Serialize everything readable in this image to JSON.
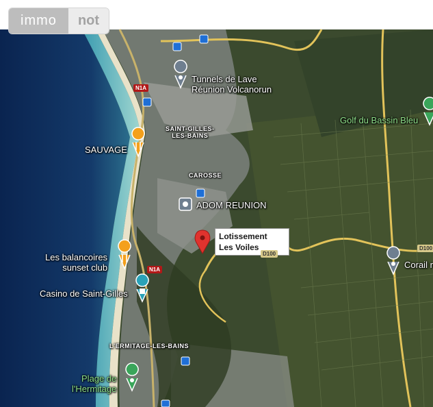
{
  "logo": {
    "part1": "immo",
    "part2": "not"
  },
  "marker": {
    "label_line1": "Lotissement",
    "label_line2": "Les Voiles"
  },
  "places": {
    "tunnels_line1": "Tunnels de Lave",
    "tunnels_line2": "Réunion Volcanorun",
    "golf": "Golf du Bassin Bleu",
    "saint_gilles_line1": "SAINT-GILLES-",
    "saint_gilles_line2": "LES-BAINS",
    "sauvage": "SAUVAGE",
    "carosse": "CAROSSE",
    "adom": "ADOM REUNION",
    "balancoires_line1": "Les balancoires",
    "balancoires_line2": "sunset club",
    "casino": "Casino de Saint-Gilles",
    "corail": "Corail r",
    "ermitage": "L'ERMITAGE-LES-BAINS",
    "plage_line1": "Plage de",
    "plage_line2": "l'Hermitage"
  },
  "roads": {
    "n1a_top": "N1A",
    "n1a_mid": "N1A",
    "d100_a": "D100",
    "d100_b": "D100"
  },
  "colors": {
    "ocean": "#0b2a55",
    "land": "#3a4a2c",
    "pin": "#e0332e",
    "urban": "#8a8e8c"
  }
}
